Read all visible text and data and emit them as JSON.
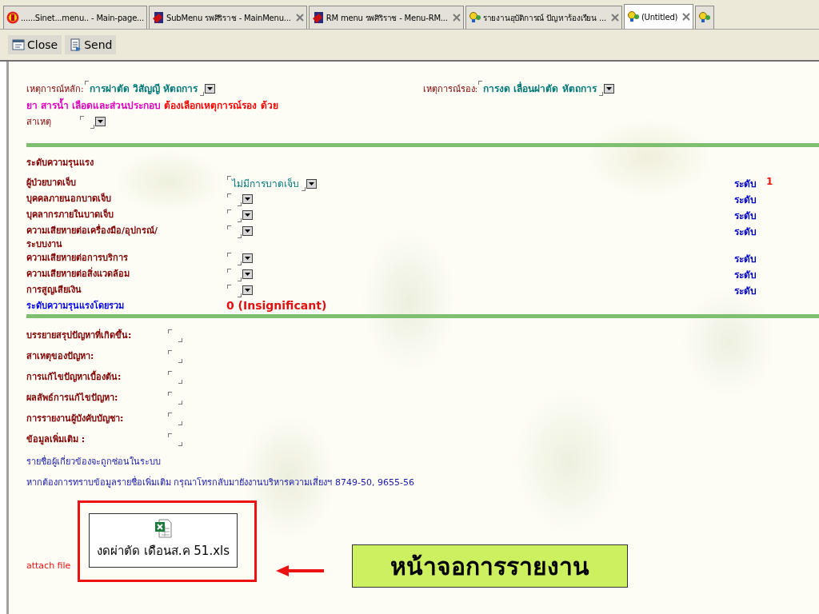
{
  "tabs": [
    {
      "label": "......Sinet...menu.. - Main-page...",
      "kind": "logo",
      "selected": false,
      "closable": false
    },
    {
      "label": "SubMenu รพศิริราช - MainMenu...",
      "kind": "page",
      "selected": false,
      "closable": true
    },
    {
      "label": "RM menu รพศิริราช - Menu-RM...",
      "kind": "page",
      "selected": false,
      "closable": true
    },
    {
      "label": "รายงานอุบัติการณ์ ปัญหาร้องเรียน ...",
      "kind": "bulb",
      "selected": false,
      "closable": true
    },
    {
      "label": "(Untitled)",
      "kind": "bulb",
      "selected": true,
      "closable": true
    },
    {
      "kind": "bulb",
      "selected": false,
      "closable": false
    }
  ],
  "toolbar": [
    {
      "label": "Close",
      "kind": "close"
    },
    {
      "label": "Send",
      "kind": "send"
    }
  ],
  "events": {
    "main": {
      "label": "เหตุการณ์หลัก:",
      "value": "การผ่าตัด วิสัญญี หัตถการ"
    },
    "secondary": {
      "label": "เหตุการณ์รอง:",
      "value": "การงด เลื่อนผ่าตัด หัตถการ"
    },
    "note": [
      {
        "text": "ยา สารน้ำ เลือดและส่วนประกอบ",
        "color": "#e000c0"
      },
      {
        "text": "ต้องเลือกเหตุการณ์รอง ด้วย",
        "color": "#ff0000"
      }
    ],
    "cause": {
      "label": "สาเหตุ"
    }
  },
  "severity": {
    "heading": "ระดับความรุนแรง",
    "rows": [
      {
        "label": "ผู้ป่วยบาดเจ็บ",
        "value": "ไม่มีการบาดเจ็บ",
        "level_label": "ระดับ",
        "level_value": "1"
      },
      {
        "label": "บุคคลภายนอกบาดเจ็บ",
        "level_label": "ระดับ"
      },
      {
        "label": "บุคลากรภายในบาดเจ็บ",
        "level_label": "ระดับ"
      },
      {
        "label": "ความเสียหายต่อเครื่องมือ/อุปกรณ์/ระบบงาน",
        "level_label": "ระดับ"
      },
      {
        "label": "ความเสียหายต่อการบริการ",
        "level_label": "ระดับ"
      },
      {
        "label": "ความเสียหายต่อสิ่งแวดล้อม",
        "level_label": "ระดับ"
      },
      {
        "label": "การสูญเสียเงิน",
        "level_label": "ระดับ"
      }
    ],
    "overall": {
      "label": "ระดับความรุนแรงโดยรวม",
      "value": "0 (Insignificant)"
    }
  },
  "details": [
    {
      "label": "บรรยายสรุปปัญหาที่เกิดขึ้น:"
    },
    {
      "label": "สาเหตุของปัญหา:"
    },
    {
      "label": "การแก้ไขปัญหาเบื้องต้น:"
    },
    {
      "label": "ผลลัพธ์การแก้ไขปัญหา:"
    },
    {
      "label": "การรายงานผู้บังคับบัญชา:"
    },
    {
      "label": "ข้อมูลเพิ่มเติม :"
    }
  ],
  "notices": [
    "รายชื่อผู้เกี่ยวข้องจะถูกซ่อนในระบบ",
    "หากต้องการทราบข้อมูลรายชื่อเพิ่มเติม กรุณาโทรกลับมายังงานบริหารความเสี่ยงฯ  8749-50, 9655-56"
  ],
  "attachment": {
    "label": "attach file",
    "file_name": "งดผ่าตัด เดือนส.ค 51.xls"
  },
  "callout": {
    "text": "หน้าจอการรายงาน"
  }
}
